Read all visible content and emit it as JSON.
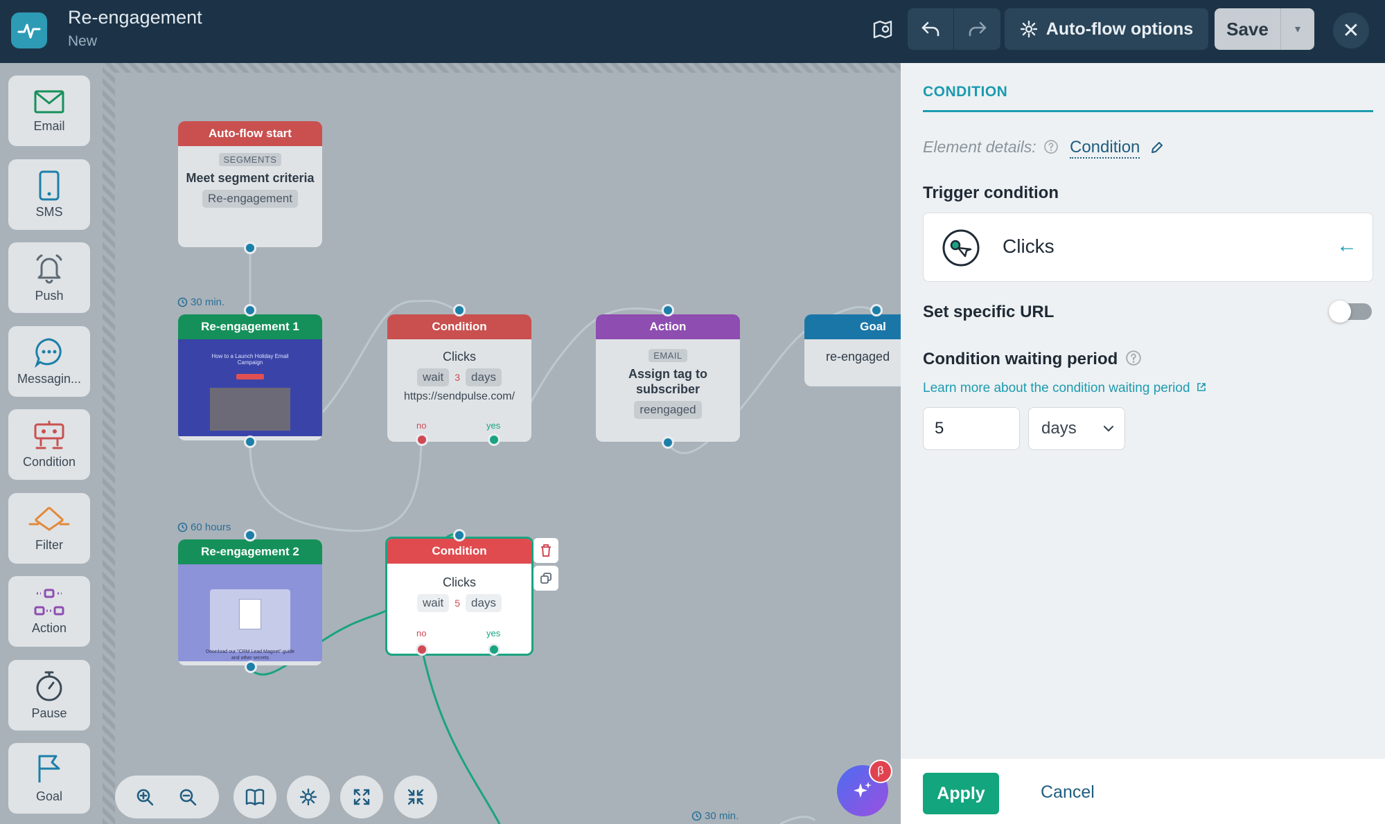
{
  "header": {
    "title": "Re-engagement",
    "status": "New",
    "options_label": "Auto-flow options",
    "save_label": "Save"
  },
  "palette": [
    {
      "label": "Email",
      "icon": "envelope-icon"
    },
    {
      "label": "SMS",
      "icon": "phone-icon"
    },
    {
      "label": "Push",
      "icon": "bell-icon"
    },
    {
      "label": "Messagin...",
      "icon": "chat-bubble-icon"
    },
    {
      "label": "Condition",
      "icon": "condition-icon"
    },
    {
      "label": "Filter",
      "icon": "filter-icon"
    },
    {
      "label": "Action",
      "icon": "action-icon"
    },
    {
      "label": "Pause",
      "icon": "stopwatch-icon"
    },
    {
      "label": "Goal",
      "icon": "flag-icon"
    }
  ],
  "nodes": {
    "start": {
      "header": "Auto-flow start",
      "tag": "SEGMENTS",
      "text": "Meet segment criteria",
      "chip": "Re-engagement"
    },
    "email1": {
      "header": "Re-engagement 1",
      "timer": "30 min.",
      "thumb_text": "How to a Launch Holiday Email Campaign"
    },
    "cond1": {
      "header": "Condition",
      "text": "Clicks",
      "wait": "wait",
      "wait_num": "3",
      "unit": "days",
      "url": "https://sendpulse.com/",
      "no": "no",
      "yes": "yes"
    },
    "action": {
      "header": "Action",
      "tag": "EMAIL",
      "text": "Assign tag to subscriber",
      "chip": "reengaged"
    },
    "goal": {
      "header": "Goal",
      "text": "re-engaged"
    },
    "email2": {
      "header": "Re-engagement 2",
      "timer": "60 hours",
      "thumb_text": "Download our \"CRM Lead Magnet\" guide and other secrets"
    },
    "cond2": {
      "header": "Condition",
      "text": "Clicks",
      "wait": "wait",
      "wait_num": "5",
      "unit": "days",
      "no": "no",
      "yes": "yes"
    },
    "bottom_timer": "30 min."
  },
  "ai": {
    "badge": "β"
  },
  "panel": {
    "title": "CONDITION",
    "details_label": "Element details:",
    "details_value": "Condition",
    "trigger_title": "Trigger condition",
    "trigger_value": "Clicks",
    "specific_url_label": "Set specific URL",
    "specific_url_on": false,
    "waiting_title": "Condition waiting period",
    "learn_link": "Learn more about the condition waiting period",
    "waiting_value": "5",
    "waiting_unit": "days",
    "apply": "Apply",
    "cancel": "Cancel"
  },
  "colors": {
    "topbar": "#1c3347",
    "accent": "#1b9bb0",
    "start": "#c9504f",
    "email": "#16905a",
    "condition": "#c9504f",
    "action": "#8e4db0",
    "goal": "#1b76a8",
    "apply": "#13a57e"
  }
}
